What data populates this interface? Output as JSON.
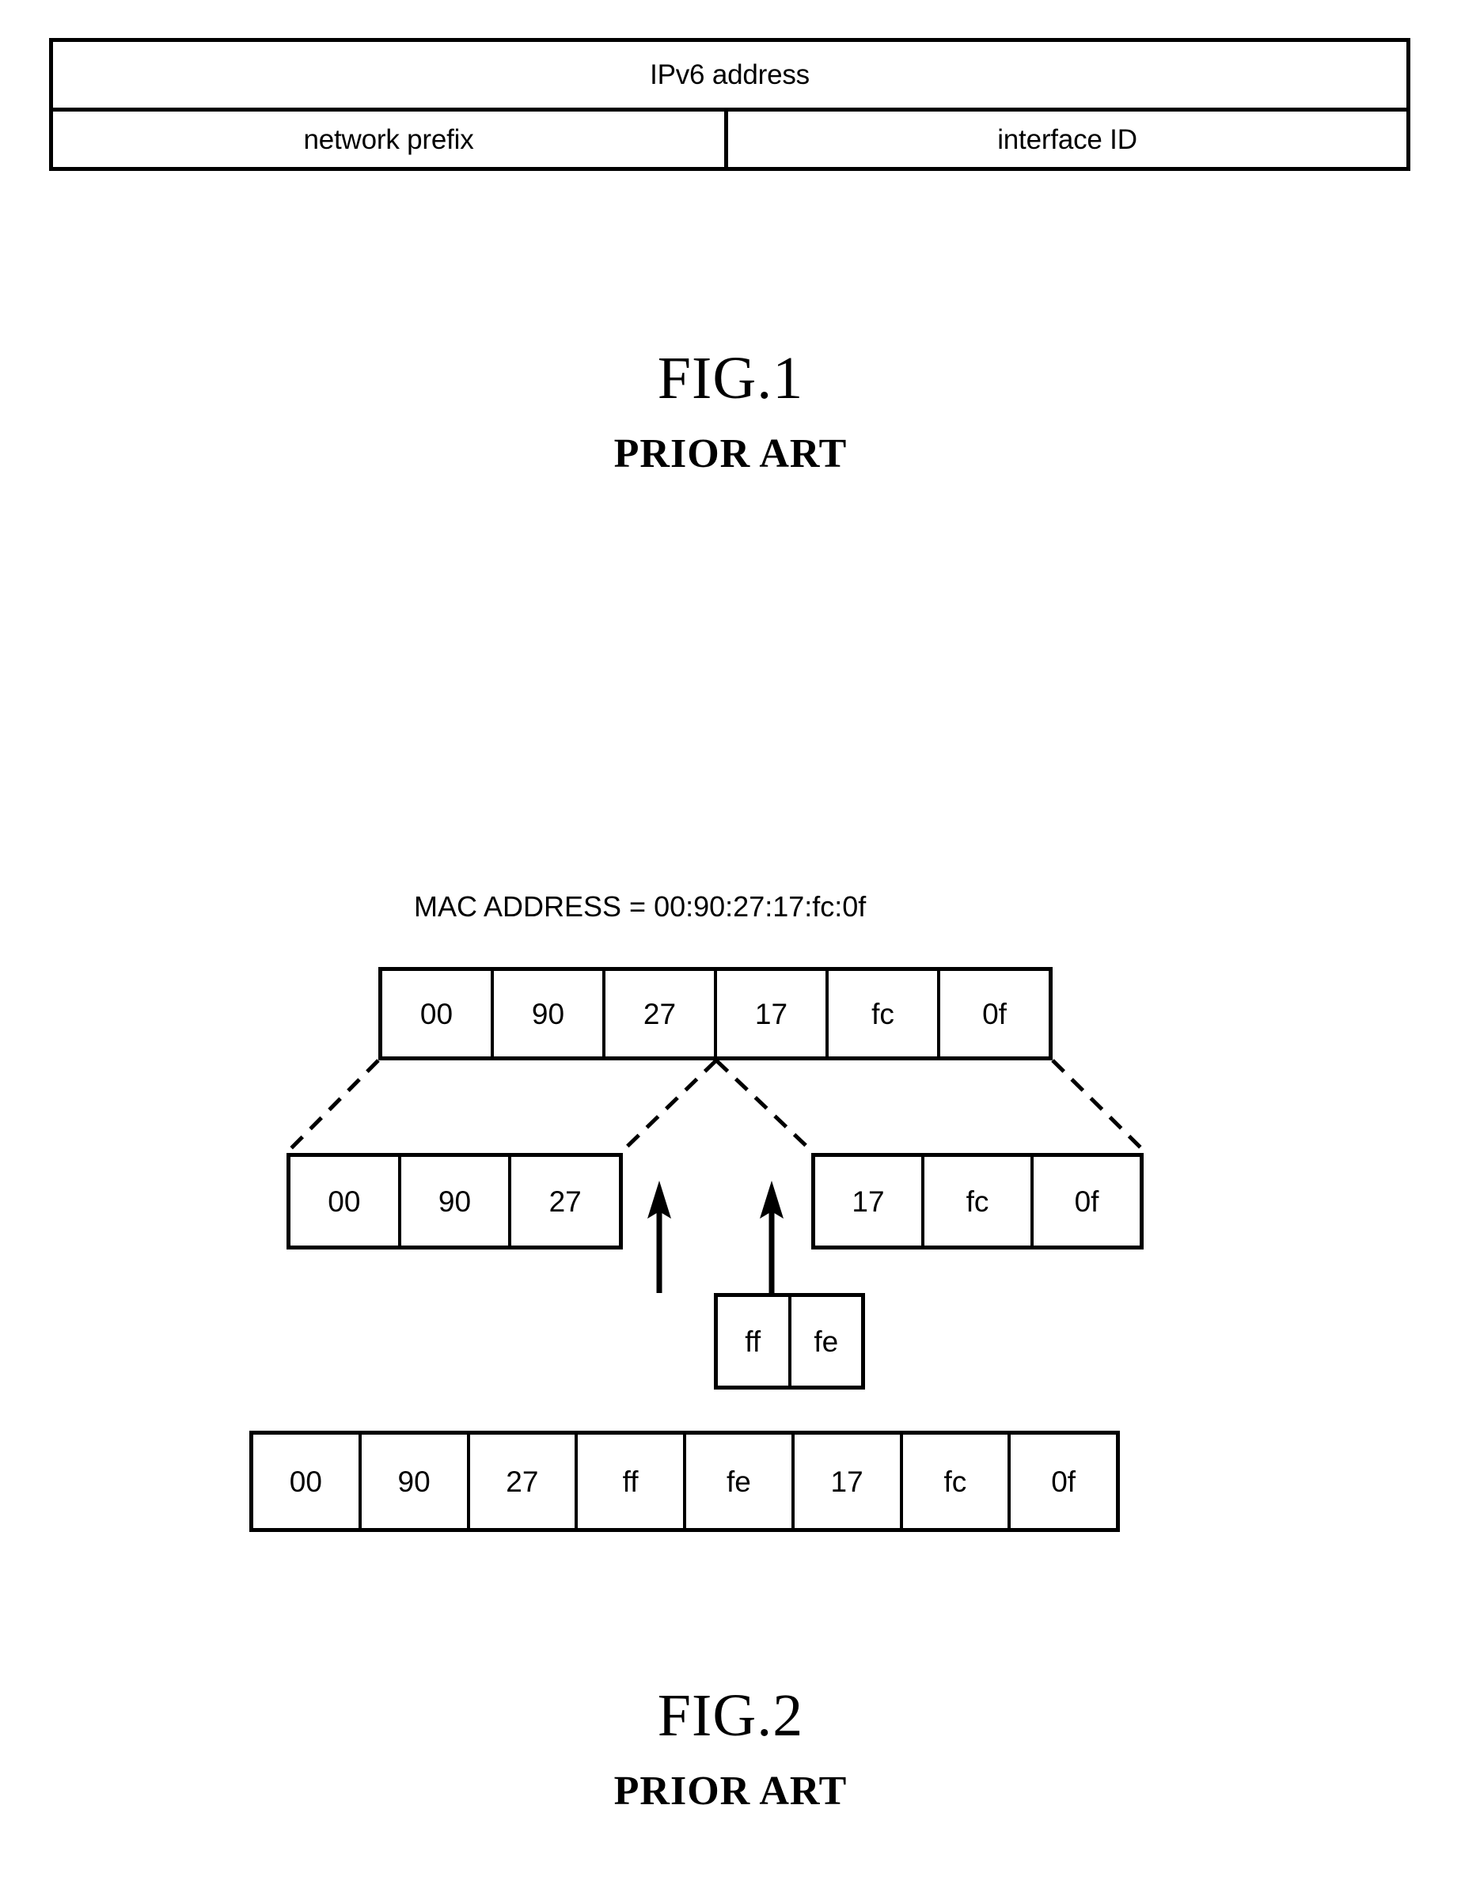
{
  "figure1": {
    "title_row": {
      "label": "IPv6 address"
    },
    "split_row": {
      "left_label": "network prefix",
      "right_label": "interface ID"
    },
    "caption": {
      "number": "FIG.1",
      "subtitle": "PRIOR ART"
    }
  },
  "figure2": {
    "mac_title": "MAC ADDRESS = 00:90:27:17:fc:0f",
    "mac_row": {
      "name": "mac-address-bytes",
      "cells": [
        "00",
        "90",
        "27",
        "17",
        "fc",
        "0f"
      ]
    },
    "left_group": {
      "name": "oui-bytes",
      "cells": [
        "00",
        "90",
        "27"
      ]
    },
    "right_group": {
      "name": "nic-bytes",
      "cells": [
        "17",
        "fc",
        "0f"
      ]
    },
    "inserted_group": {
      "name": "inserted-ff-fe-bytes",
      "cells": [
        "ff",
        "fe"
      ]
    },
    "final_row": {
      "name": "eui64-bytes",
      "cells": [
        "00",
        "90",
        "27",
        "ff",
        "fe",
        "17",
        "fc",
        "0f"
      ]
    },
    "caption": {
      "number": "FIG.2",
      "subtitle": "PRIOR ART"
    }
  },
  "style": {
    "ink_color": "#000000",
    "paper_color": "#ffffff"
  }
}
